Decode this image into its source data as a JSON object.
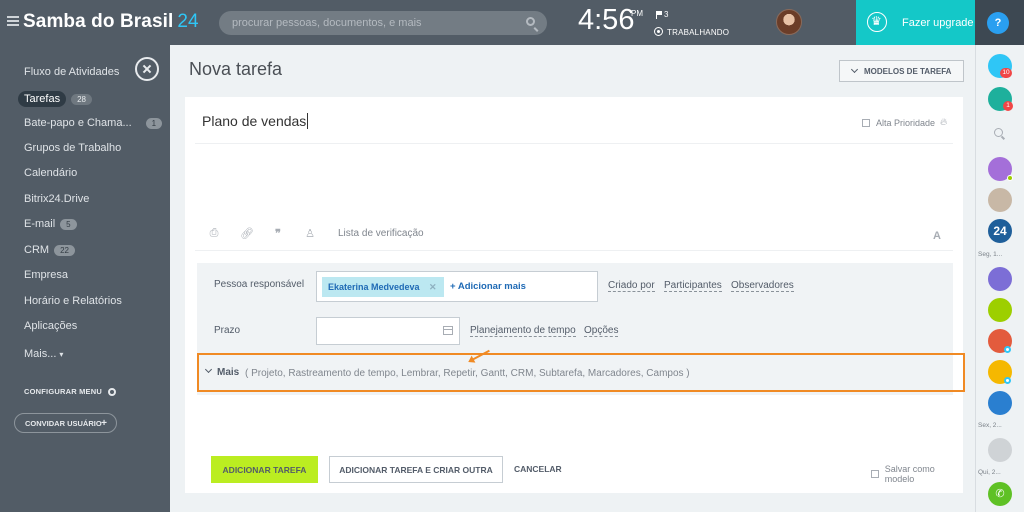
{
  "header": {
    "brand_name": "Samba do Brasil",
    "brand_number": "24",
    "search_placeholder": "procurar pessoas, documentos, e mais",
    "time": "4:56",
    "ampm": "PM",
    "flag_count": "3",
    "work_status": "TRABALHANDO",
    "upgrade_label": "Fazer upgrade",
    "help_label": "?"
  },
  "sidebar": {
    "items": [
      {
        "label": "Fluxo de Atividades",
        "badge": ""
      },
      {
        "label": "Tarefas",
        "badge": "28"
      },
      {
        "label": "Bate-papo e Chama...",
        "badge": "1"
      },
      {
        "label": "Grupos de Trabalho",
        "badge": ""
      },
      {
        "label": "Calendário",
        "badge": ""
      },
      {
        "label": "Bitrix24.Drive",
        "badge": ""
      },
      {
        "label": "E-mail",
        "badge": "5"
      },
      {
        "label": "CRM",
        "badge": "22"
      },
      {
        "label": "Empresa",
        "badge": ""
      },
      {
        "label": "Horário e Relatórios",
        "badge": ""
      },
      {
        "label": "Aplicações",
        "badge": ""
      },
      {
        "label": "Mais...",
        "badge": ""
      }
    ],
    "configure_label": "CONFIGURAR MENU",
    "invite_label": "CONVIDAR USUÁRIO",
    "invite_plus": "+"
  },
  "main": {
    "page_title": "Nova tarefa",
    "templates_label": "MODELOS DE TAREFA",
    "task_title": "Plano de vendas",
    "priority_label": "Alta Prioridade",
    "checklist_label": "Lista de verificação",
    "responsible_label": "Pessoa responsável",
    "responsible_person": "Ekaterina Medvedeva",
    "add_more_label": "+ Adicionar mais",
    "created_by": "Criado por",
    "participants": "Participantes",
    "observers": "Observadores",
    "deadline_label": "Prazo",
    "time_planning": "Planejamento de tempo",
    "options": "Opções",
    "more_label": "Mais",
    "more_items": "( Projeto,  Rastreamento de tempo,  Lembrar,  Repetir,  Gantt,  CRM,  Subtarefa,  Marcadores,  Campos )",
    "add_task_label": "ADICIONAR TAREFA",
    "add_another_label": "ADICIONAR TAREFA E CRIAR OUTRA",
    "cancel_label": "CANCELAR",
    "save_template_label": "Salvar como modelo"
  },
  "rightbar": {
    "badge_1": "10",
    "badge_2": "1",
    "label_1": "Seg, 1...",
    "label_2": "Sex, 2...",
    "label_3": "Qui, 2..."
  },
  "colors": {
    "accent_upgrade": "#14c8c8",
    "add_button": "#bbed21",
    "highlight_border": "#f08a24",
    "brand_number": "#2fc6f6"
  }
}
